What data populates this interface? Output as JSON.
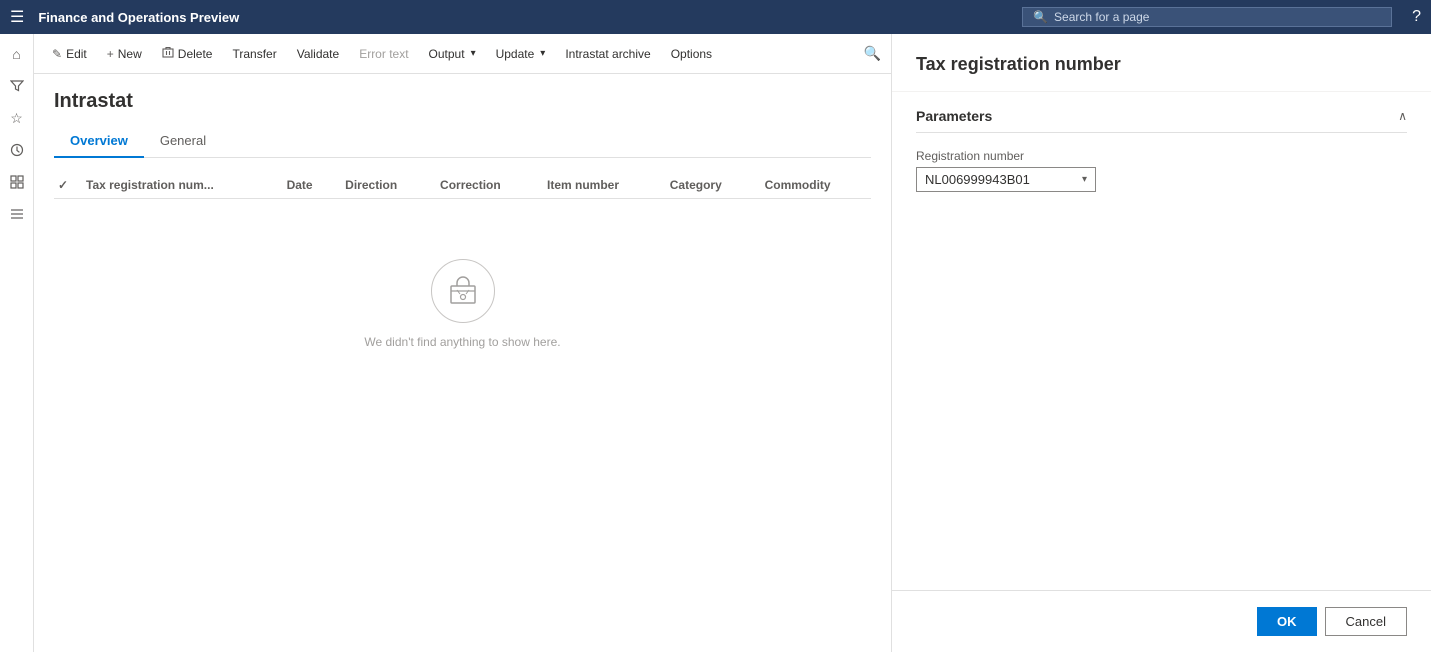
{
  "app": {
    "title": "Finance and Operations Preview",
    "hamburger_icon": "☰",
    "help_icon": "?"
  },
  "search": {
    "placeholder": "Search for a page",
    "icon": "🔍"
  },
  "sidebar": {
    "icons": [
      {
        "name": "home-icon",
        "symbol": "⌂"
      },
      {
        "name": "filter-icon",
        "symbol": "⚗"
      },
      {
        "name": "favorites-icon",
        "symbol": "☆"
      },
      {
        "name": "recent-icon",
        "symbol": "🕐"
      },
      {
        "name": "workspaces-icon",
        "symbol": "⊞"
      },
      {
        "name": "modules-icon",
        "symbol": "≡"
      }
    ]
  },
  "toolbar": {
    "edit_label": "Edit",
    "new_label": "New",
    "delete_label": "Delete",
    "transfer_label": "Transfer",
    "validate_label": "Validate",
    "error_text_label": "Error text",
    "output_label": "Output",
    "update_label": "Update",
    "intrastat_archive_label": "Intrastat archive",
    "options_label": "Options",
    "edit_icon": "✎",
    "new_icon": "+",
    "delete_icon": "🗑",
    "search_icon": "🔍"
  },
  "page": {
    "title": "Intrastat",
    "tabs": [
      {
        "id": "overview",
        "label": "Overview",
        "active": true
      },
      {
        "id": "general",
        "label": "General",
        "active": false
      }
    ]
  },
  "table": {
    "columns": [
      {
        "id": "check",
        "label": "✓"
      },
      {
        "id": "tax_reg_num",
        "label": "Tax registration num..."
      },
      {
        "id": "date",
        "label": "Date"
      },
      {
        "id": "direction",
        "label": "Direction"
      },
      {
        "id": "correction",
        "label": "Correction"
      },
      {
        "id": "item_number",
        "label": "Item number"
      },
      {
        "id": "category",
        "label": "Category"
      },
      {
        "id": "commodity",
        "label": "Commodity"
      }
    ],
    "empty_state": {
      "icon": "📁",
      "message": "We didn't find anything to show here."
    }
  },
  "right_panel": {
    "title": "Tax registration number",
    "section": {
      "title": "Parameters",
      "collapse_icon": "∧"
    },
    "field": {
      "label": "Registration number",
      "value": "NL006999943B01",
      "chevron": "▾"
    },
    "footer": {
      "ok_label": "OK",
      "cancel_label": "Cancel"
    }
  }
}
